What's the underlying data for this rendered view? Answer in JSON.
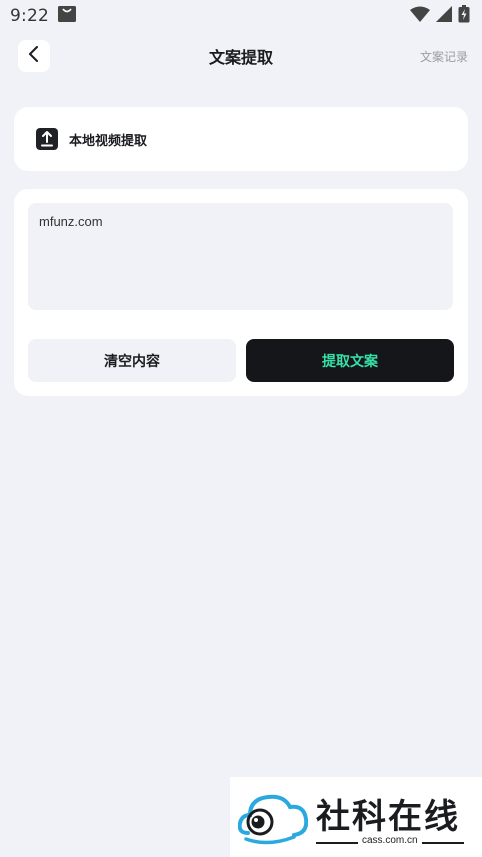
{
  "status_bar": {
    "time": "9:22"
  },
  "header": {
    "title": "文案提取",
    "records_label": "文案记录"
  },
  "upload": {
    "label": "本地视频提取"
  },
  "editor": {
    "value": "mfunz.com"
  },
  "actions": {
    "clear_label": "清空内容",
    "extract_label": "提取文案"
  },
  "watermark": {
    "brand": "社科在线",
    "site": "cass.com.cn"
  },
  "colors": {
    "background": "#f1f2f7",
    "card": "#ffffff",
    "primary_button": "#15161a",
    "primary_button_text": "#37e0a6",
    "logo_blue": "#2aa9e0"
  }
}
